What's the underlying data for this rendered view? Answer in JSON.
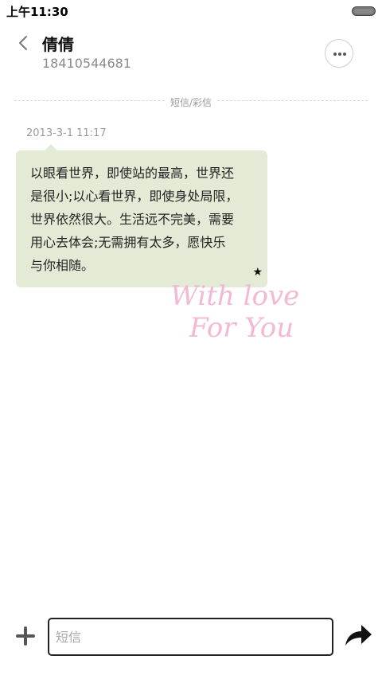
{
  "status_bar": {
    "time": "上午11:30"
  },
  "header": {
    "contact_name": "倩倩",
    "contact_phone": "18410544681"
  },
  "divider": {
    "label": "短信/彩信"
  },
  "message": {
    "timestamp": "2013-3-1 11:17",
    "lines": [
      "以眼看世界，即使站的最高，世界还",
      "是很小;以心看世界，即使身处局限，",
      "世界依然很大。生活远不完美，需要",
      "用心去体会;无需拥有太多，愿快乐",
      "与你相随。"
    ],
    "star_icon": "star-icon"
  },
  "watermark": {
    "line1": "With love",
    "line2": "For You"
  },
  "input_bar": {
    "placeholder": "短信"
  },
  "icons": {
    "back": "chevron-left-icon",
    "more": "more-dots-icon",
    "add": "plus-icon",
    "send": "send-arrow-icon"
  },
  "colors": {
    "bubble_bg": "#e3ebd6",
    "watermark": "#f3b9d4"
  }
}
